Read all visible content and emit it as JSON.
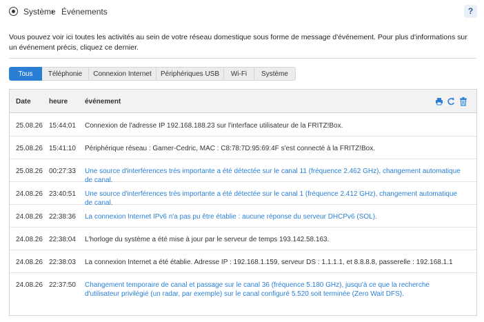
{
  "breadcrumb": {
    "section": "Système",
    "separator": "›",
    "page": "Événements"
  },
  "help": {
    "label": "?"
  },
  "intro": "Vous pouvez voir ici toutes les activités au sein de votre réseau domestique sous forme de message d'événement. Pour plus d'informations sur un événement précis, cliquez ce dernier.",
  "tabs": [
    {
      "label": "Tous",
      "active": true
    },
    {
      "label": "Téléphonie"
    },
    {
      "label": "Connexion Internet"
    },
    {
      "label": "Périphériques USB"
    },
    {
      "label": "Wi-Fi"
    },
    {
      "label": "Système"
    }
  ],
  "table": {
    "headers": {
      "date": "Date",
      "time": "heure",
      "event": "événement"
    },
    "tools": [
      "print-icon",
      "refresh-icon",
      "trash-icon"
    ],
    "rows": [
      {
        "date": "25.08.26",
        "time": "15:44:01",
        "event": "Connexion de l'adresse IP 192.168.188.23 sur l'interface utilisateur de la FRITZ!Box.",
        "link": false
      },
      {
        "date": "25.08.26",
        "time": "15:41:10",
        "event": "Périphérique réseau : Gamer-Cedric, MAC : C8:78:7D:95:69:4F s'est connecté à la FRITZ!Box.",
        "link": false
      },
      {
        "date": "25.08.26",
        "time": "00:27:33",
        "event": "Une source d'interférences très importante a été détectée sur le canal 11 (fréquence 2.462 GHz), changement automatique de canal.",
        "link": true
      },
      {
        "date": "24.08.26",
        "time": "23:40:51",
        "event": "Une source d'interférences très importante a été détectée sur le canal 1 (fréquence 2.412 GHz), changement automatique de canal.",
        "link": true
      },
      {
        "date": "24.08.26",
        "time": "22:38:36",
        "event": "La connexion Internet IPv6 n'a pas pu être établie : aucune réponse du serveur DHCPv6 (SOL).",
        "link": true
      },
      {
        "date": "24.08.26",
        "time": "22:38:04",
        "event": "L'horloge du système a été mise à jour par le serveur de temps 193.142.58.163.",
        "link": false
      },
      {
        "date": "24.08.26",
        "time": "22:38:03",
        "event": "La connexion Internet a été établie. Adresse IP : 192.168.1.159, serveur DS : 1.1.1.1, et 8.8.8.8, passerelle : 192.168.1.1",
        "link": false
      },
      {
        "date": "24.08.26",
        "time": "22:37:50",
        "event": "Changement temporaire de canal et passage sur le canal 36 (fréquence 5.180 GHz), jusqu'à ce que la recherche d'utilisateur privilégié (un radar, par exemple) sur le canal configuré 5.520 soit terminée (Zero Wait DFS).",
        "link": true
      }
    ]
  },
  "colors": {
    "accent": "#2a7fd4",
    "header_bg": "#f2f2f2"
  }
}
